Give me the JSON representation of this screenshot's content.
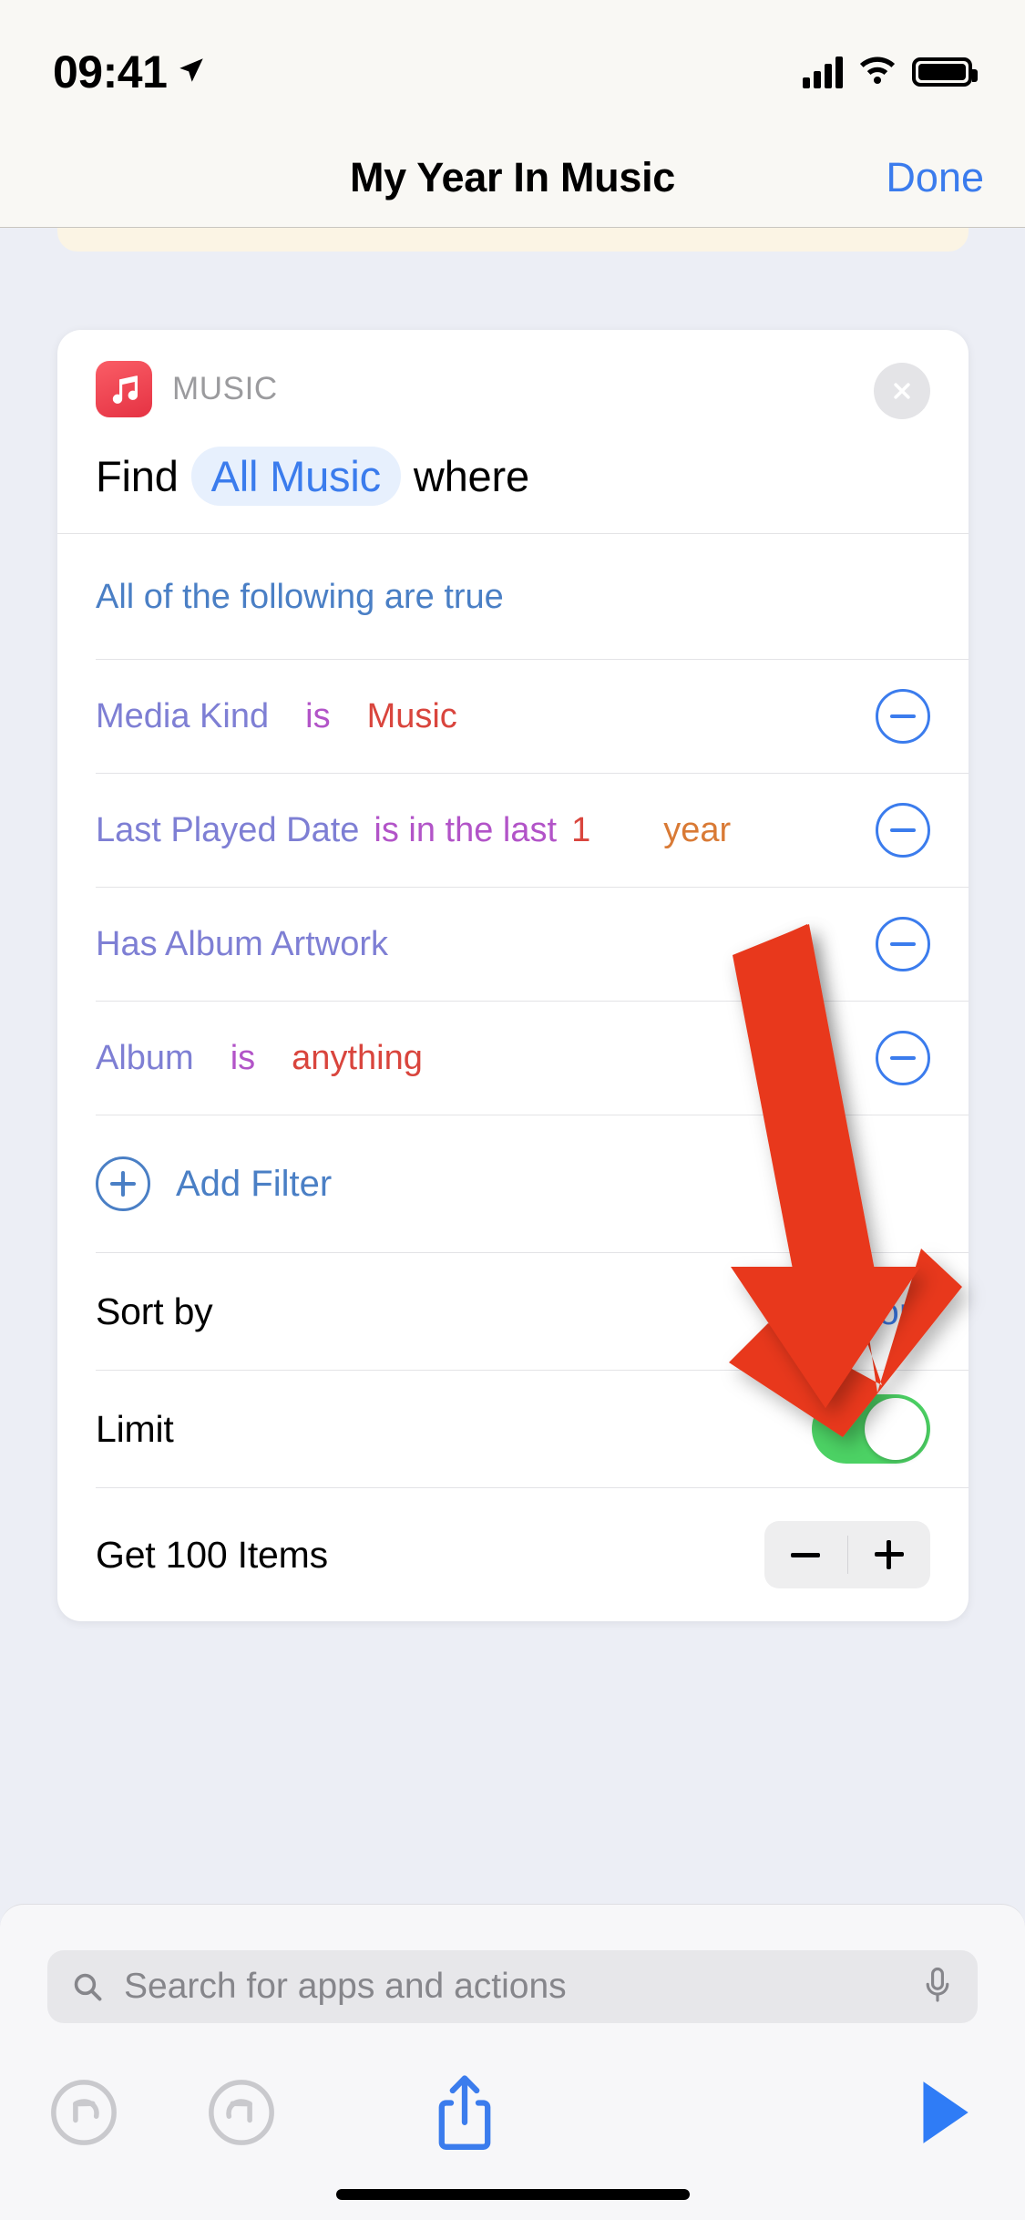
{
  "status_bar": {
    "time": "09:41",
    "location_icon": "location-arrow-icon",
    "cellular_icon": "cellular-bars-icon",
    "wifi_icon": "wifi-icon",
    "battery_icon": "battery-full-icon"
  },
  "nav": {
    "title": "My Year In Music",
    "done_label": "Done"
  },
  "action_card": {
    "app_name": "MUSIC",
    "app_icon": "music-note-icon",
    "close_icon": "close-circle-icon",
    "find_prefix": "Find",
    "find_target": "All Music",
    "find_suffix": "where",
    "condition_header": "All of the following are true",
    "filters": [
      {
        "attribute": "Media Kind",
        "operator": "is",
        "value": "Music",
        "unit": "",
        "remove_icon": "minus-circle-icon"
      },
      {
        "attribute": "Last Played Date",
        "operator": "is in the last",
        "value": "1",
        "unit": "year",
        "remove_icon": "minus-circle-icon"
      },
      {
        "attribute": "Has Album Artwork",
        "operator": "",
        "value": "",
        "unit": "",
        "remove_icon": "minus-circle-icon"
      },
      {
        "attribute": "Album",
        "operator": "is",
        "value": "anything",
        "unit": "",
        "remove_icon": "minus-circle-icon"
      }
    ],
    "add_filter_label": "Add Filter",
    "add_filter_icon": "plus-circle-icon",
    "sort_by_label": "Sort by",
    "sort_by_value": "Random",
    "limit_label": "Limit",
    "limit_enabled": true,
    "get_items_label": "Get 100 Items",
    "stepper_minus_icon": "minus-icon",
    "stepper_plus_icon": "plus-icon"
  },
  "search": {
    "placeholder": "Search for apps and actions",
    "search_icon": "search-icon",
    "mic_icon": "microphone-icon"
  },
  "toolbar": {
    "undo_icon": "undo-arrow-icon",
    "redo_icon": "redo-arrow-icon",
    "share_icon": "share-icon",
    "play_icon": "play-icon"
  },
  "annotation": {
    "arrow_color": "#e8381c",
    "arrow_points_to": "Random"
  },
  "colors": {
    "accent_blue": "#3b7ced",
    "attribute_purple": "#7e7fd4",
    "operator_magenta": "#b254c8",
    "value_red": "#d9453d",
    "unit_orange": "#d97a35",
    "toggle_green": "#4cd264",
    "music_red": "#e53243"
  }
}
